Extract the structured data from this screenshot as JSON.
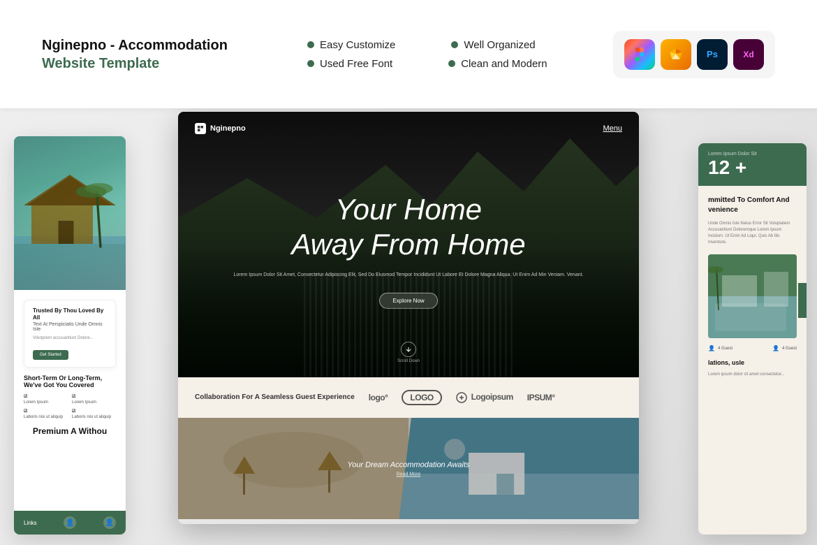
{
  "header": {
    "title_main": "Nginepno - Accommodation",
    "title_sub": "Website Template",
    "features": [
      {
        "label": "Easy Customize"
      },
      {
        "label": "Well Organized"
      },
      {
        "label": "Used Free Font"
      },
      {
        "label": "Clean and Modern"
      }
    ],
    "tools": [
      {
        "name": "Figma",
        "abbr": "F",
        "type": "figma"
      },
      {
        "name": "Sketch",
        "abbr": "S",
        "type": "sketch"
      },
      {
        "name": "Photoshop",
        "abbr": "Ps",
        "type": "ps"
      },
      {
        "name": "XD",
        "abbr": "Xd",
        "type": "xd"
      }
    ]
  },
  "hero": {
    "logo": "Nginepno",
    "menu": "Menu",
    "heading_line1": "Your Home",
    "heading_line2": "Away From Home",
    "subtext": "Lorem Ipsum Dolor Sit Amet, Consectetur Adipiscing Elit, Sed Do Eiusmod Tempor Incididunt Ut\nLabore Et Dolore Magna Aliqua. Ut Enim Ad Min Veniam. Venant.",
    "cta_button": "Explore Now",
    "scroll_label": "Scroll Down"
  },
  "logos_section": {
    "text": "Collaboration For A\nSeamless Guest Experience",
    "logos": [
      "logo°",
      "LOGO",
      "Logoipsum",
      "IPSUM°"
    ]
  },
  "dream_section": {
    "title": "Your Dream\nAccommodation Awaits",
    "read_more": "Read More"
  },
  "left_panel": {
    "trusted_title": "Trusted By Thou\nLoved By All",
    "trusted_subtitle": "Text At Perspiciatis Unde Omnis Iste",
    "trusted_text": "Volutprem accusantium Dolore...",
    "trusted_btn": "Get Started",
    "short_term_title": "Short-Term Or Long-Term,\nWe've Got You Covered",
    "items": [
      "Lorem Ipsum",
      "Lorem Ipsum",
      "Laboris nisi ut aliquip",
      "Laboris nisi ut aliquip"
    ],
    "premium_title": "Premium A\nWithou",
    "links_label": "Links"
  },
  "right_panel": {
    "stat_label": "Lorem Ipsum Dolor Sit",
    "stat_value": "12 +",
    "committed_title": "mmitted To\nComfort And\nvenience",
    "committed_text": "Unde Omnis Iste Natus Error Sit Voluptatem Accusantium Doloremque Lorem Ipsum\nIncidum. Ut Enim Ad Liqui. Quis Ab Illo Inventore.",
    "guest_labels": [
      "4 Guest",
      "4 Guest"
    ],
    "relations_title": "lations,\nusle",
    "relations_text": "Lorem ipsum dolor sit amet consectetur..."
  }
}
